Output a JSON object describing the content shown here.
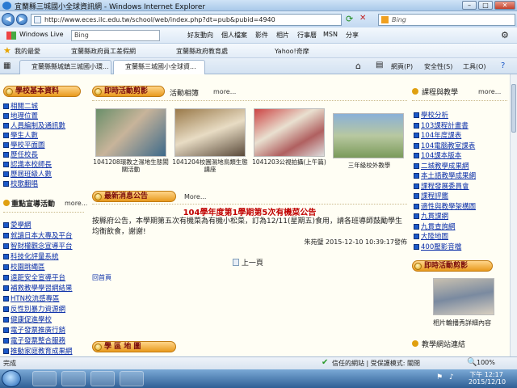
{
  "window": {
    "title": "宜蘭縣三城國小全球資訊網 - Windows Internet Explorer",
    "min": "–",
    "max": "□",
    "close": "✕"
  },
  "address": {
    "url": "http://www.eces.ilc.edu.tw/school/web/index.php?dt=pub&pubid=4940",
    "search_placeholder": "Bing"
  },
  "livebar": {
    "brand": "Windows Live",
    "search_value": "Bing",
    "items": [
      "好友動向",
      "個人檔案",
      "影件",
      "相片",
      "行事曆",
      "MSN",
      "分享"
    ]
  },
  "favorites": {
    "label": "我的最愛",
    "items": [
      "宜蘭縣政府員工差假網",
      "宜蘭縣政府教育處",
      "Yahoo!奇摩"
    ]
  },
  "tabs": {
    "items": [
      "宜蘭縣縣城鎮三城國小環...",
      "宜蘭縣三城國小全球資..."
    ],
    "commands": [
      "網頁(P)",
      "安全性(S)",
      "工具(O)"
    ]
  },
  "left_col": {
    "school_head": "學校基本資料",
    "school_links": [
      "相關二城",
      "地理位置",
      "人員編制及通訊數",
      "學生人數",
      "學校平面圖",
      "歷任校長",
      "認識本校師長",
      "歷屆班級人數",
      "校歌翻唱"
    ],
    "promo_head": "重點宣導活動",
    "promo_more": "more...",
    "promo_links": [
      "愛學網",
      "就讀日本大專及平台",
      "智財權觀念宣導平台",
      "科技化評量系統",
      "校園跳繩區",
      "遠距安全宣導平台",
      "補救教學學習網結果",
      "HTN校流感專區",
      "反性別暴力資源網",
      "健康促進學校",
      "電子發票推廣行銷",
      "電子發票整合服務",
      "推動家庭教育成果網"
    ]
  },
  "photos": {
    "head": "即時活動剪影",
    "section": "活動相簿",
    "more": "more...",
    "items": [
      {
        "caption": "1041208環教之濕地生態闖關活動"
      },
      {
        "caption": "1041204校園濕地鳥類生態講座"
      },
      {
        "caption": "1041203公視拍攝(上午篇)"
      },
      {
        "caption": "三年級校外教學"
      }
    ]
  },
  "news": {
    "head": "最新消息公告",
    "more": "More...",
    "title": "104學年度第1學期第5次有機菜公告",
    "body": "按縣府公告，本學期第五次有機菜為有機小松菜，訂為12/11(星期五)食用，請各班導師鼓勵學生均衡飲食，謝謝!",
    "author_date": "朱苑璧  2015-12-10 10:39:17發佈",
    "prev": "上一頁",
    "home": "回首頁"
  },
  "right_col": {
    "head": "課程與教學",
    "more": "more...",
    "links": [
      "學校分析",
      "103課程計畫書",
      "104年度課表",
      "104電腦教室課表",
      "104課本版本",
      "二城教學成果網",
      "本土語教學成果網",
      "課程發展委員會",
      "課程評鑑",
      "適性與教學架構圖",
      "九貫課網",
      "九貫查詢網",
      "大陸地圖",
      "400壓影音檔"
    ],
    "photo_head": "即時活動剪影",
    "photo_caption": "相片輪播秀詳細內容",
    "bottom_head": "教學網站連結"
  },
  "bottom_center_head": "學 區 地 圖",
  "statusbar": {
    "left": "完成",
    "zone": "信任的網站 | 受保護模式: 關閉",
    "zoom": "100%"
  },
  "taskbar": {
    "time": "下午 12:17",
    "date": "2015/12/10"
  }
}
